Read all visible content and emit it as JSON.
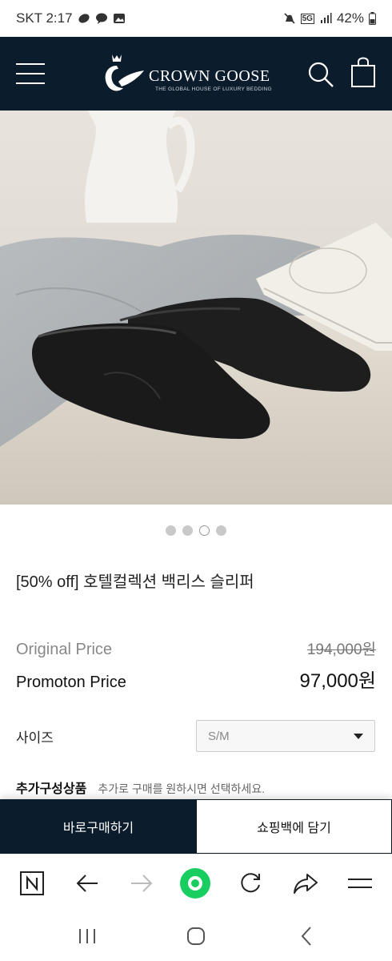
{
  "status_bar": {
    "carrier_time": "SKT 2:17",
    "network": "5G",
    "battery": "42%",
    "icons": [
      "messenger-icon",
      "talk-icon",
      "gallery-icon",
      "mute-icon",
      "signal-icon",
      "battery-icon"
    ]
  },
  "header": {
    "brand_name": "CROWN GOOSE",
    "brand_tagline": "THE GLOBAL HOUSE OF LUXURY BEDDING",
    "icons": [
      "menu-icon",
      "search-icon",
      "shopping-bag-icon"
    ]
  },
  "carousel": {
    "total_dots": 4,
    "active_index": 2
  },
  "product": {
    "title": "[50% off] 호텔컬렉션 백리스 슬리퍼",
    "original_price_label": "Original Price",
    "original_price": "194,000원",
    "promo_price_label": "Promoton Price",
    "promo_price": "97,000원"
  },
  "options": {
    "size_label": "사이즈",
    "size_selected": "S/M",
    "addon_label": "추가구성상품",
    "addon_hint": "추가로 구매를 원하시면 선택하세요."
  },
  "purchase": {
    "buy_now": "바로구매하기",
    "add_to_bag": "쇼핑백에 담기"
  },
  "browser_toolbar": {
    "icons": [
      "naver-icon",
      "back-arrow-icon",
      "forward-arrow-icon",
      "green-dot-icon",
      "refresh-icon",
      "share-icon",
      "menu-icon"
    ]
  },
  "android_nav": {
    "icons": [
      "recents-icon",
      "home-icon",
      "back-icon"
    ]
  },
  "colors": {
    "brand_navy": "#0b1c2c",
    "naver_green": "#19ce60"
  }
}
